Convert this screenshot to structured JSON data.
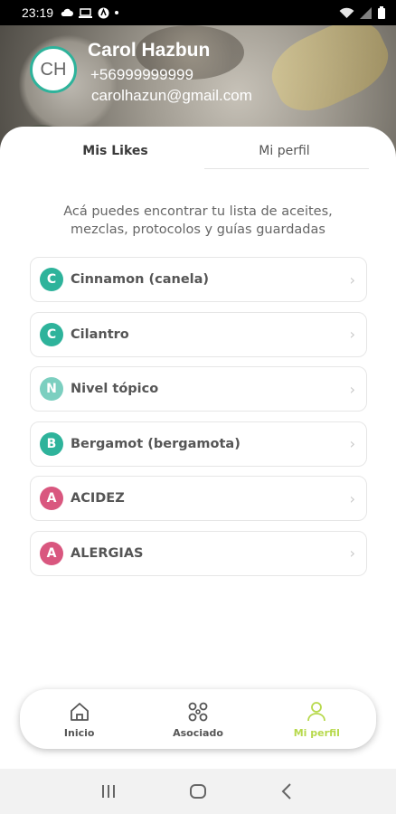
{
  "status_bar": {
    "time": "23:19",
    "icons": [
      "cloud-icon",
      "laptop-icon",
      "app-icon",
      "dot-icon",
      "wifi-icon",
      "signal-icon",
      "battery-icon"
    ]
  },
  "profile": {
    "initials": "CH",
    "name": "Carol Hazbun",
    "phone": "+56999999999",
    "email": "carolhazun@gmail.com"
  },
  "tabs": [
    {
      "label": "Mis Likes",
      "active": true
    },
    {
      "label": "Mi perfil",
      "active": false
    }
  ],
  "description": "Acá puedes encontrar tu lista de aceites, mezclas, protocolos y guías guardadas",
  "likes": [
    {
      "letter": "C",
      "label": "Cinnamon (canela)",
      "color": "#2eb39b"
    },
    {
      "letter": "C",
      "label": "Cilantro",
      "color": "#2eb39b"
    },
    {
      "letter": "N",
      "label": "Nivel tópico",
      "color": "#7ccfc0"
    },
    {
      "letter": "B",
      "label": "Bergamot (bergamota)",
      "color": "#2eb39b"
    },
    {
      "letter": "A",
      "label": "ACIDEZ",
      "color": "#d9577f"
    },
    {
      "letter": "A",
      "label": "ALERGIAS",
      "color": "#d9577f"
    }
  ],
  "bottom_nav": [
    {
      "label": "Inicio",
      "icon": "home-icon",
      "active": false
    },
    {
      "label": "Asociado",
      "icon": "network-icon",
      "active": false
    },
    {
      "label": "Mi perfil",
      "icon": "person-icon",
      "active": true
    }
  ],
  "colors": {
    "accent_teal": "#2eb39b",
    "accent_lime": "#b7d94c",
    "accent_pink": "#d9577f"
  }
}
